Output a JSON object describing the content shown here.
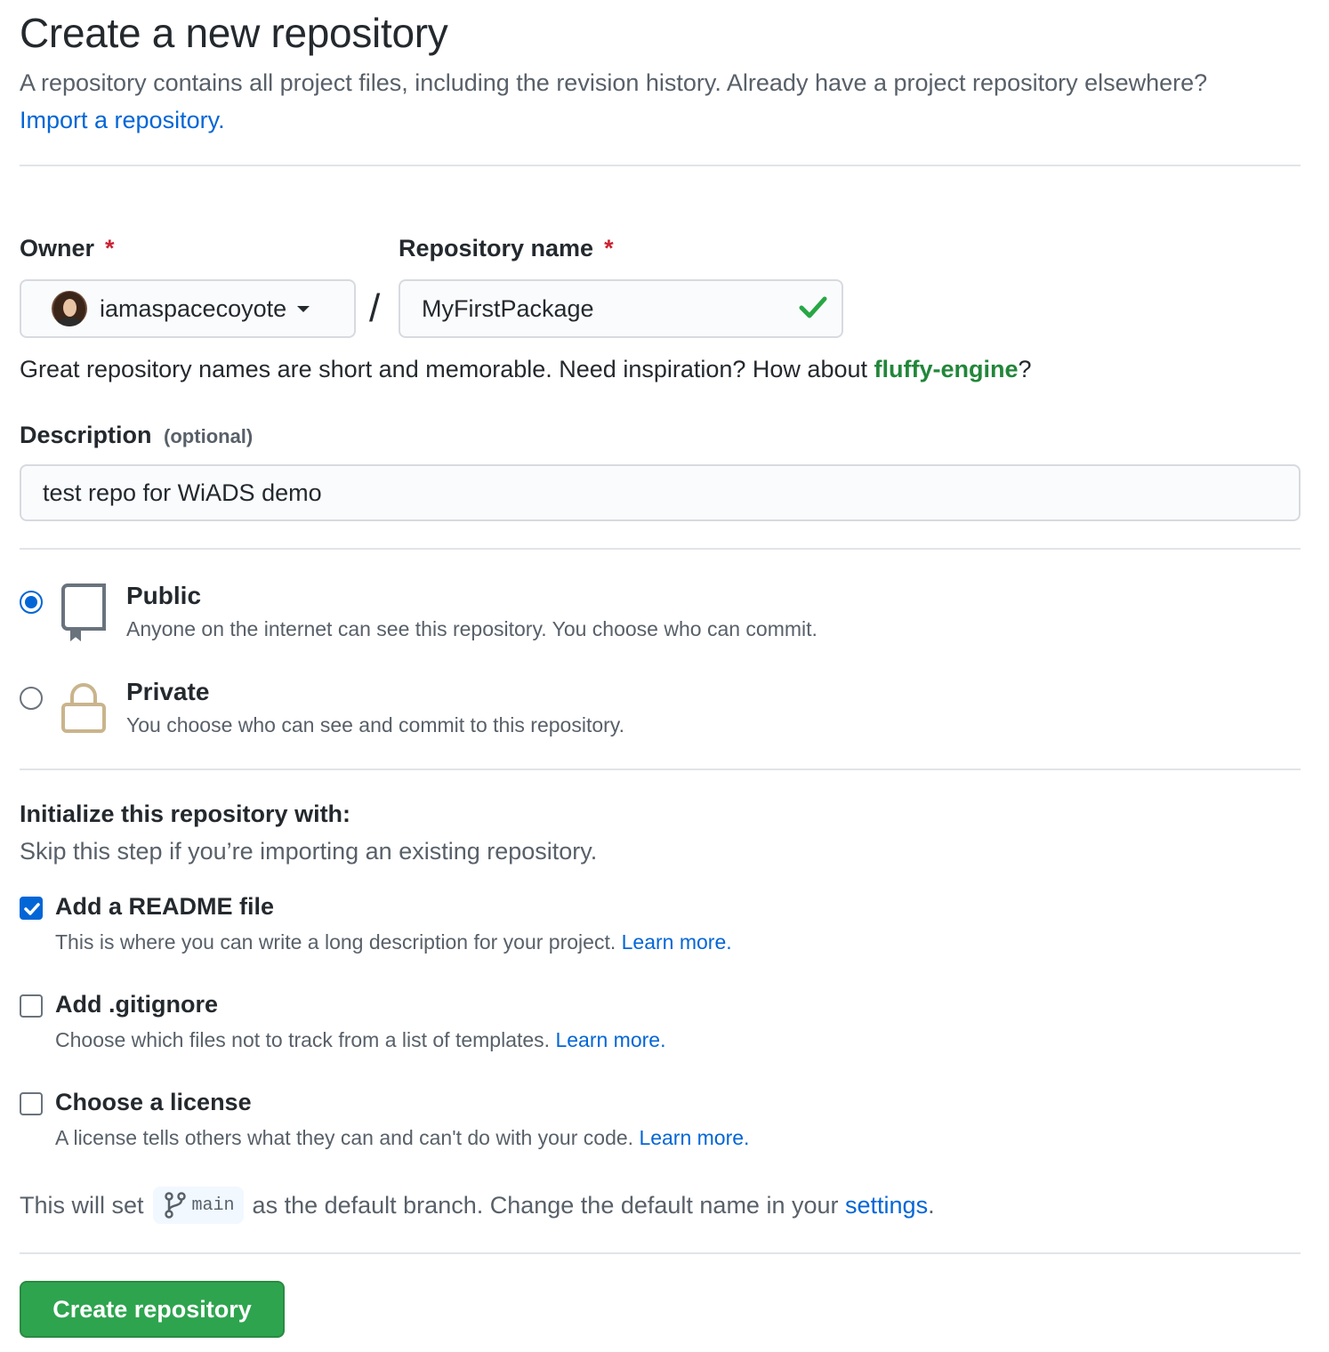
{
  "header": {
    "title": "Create a new repository",
    "subtitle": "A repository contains all project files, including the revision history. Already have a project repository elsewhere?",
    "import_link": "Import a repository."
  },
  "owner": {
    "label": "Owner",
    "required_mark": "*",
    "selected": "iamaspacecoyote"
  },
  "repo_name": {
    "label": "Repository name",
    "required_mark": "*",
    "value": "MyFirstPackage",
    "separator": "/"
  },
  "name_hint": {
    "text": "Great repository names are short and memorable. Need inspiration? How about",
    "suggestion": "fluffy-engine",
    "suffix": "?"
  },
  "description": {
    "label": "Description",
    "optional": "(optional)",
    "value": "test repo for WiADS demo"
  },
  "visibility": {
    "selected": "Public",
    "options": [
      {
        "title": "Public",
        "desc": "Anyone on the internet can see this repository. You choose who can commit."
      },
      {
        "title": "Private",
        "desc": "You choose who can see and commit to this repository."
      }
    ]
  },
  "initialize": {
    "title": "Initialize this repository with:",
    "subtitle": "Skip this step if you’re importing an existing repository.",
    "options": [
      {
        "title": "Add a README file",
        "desc": "This is where you can write a long description for your project.",
        "link": "Learn more.",
        "checked": true
      },
      {
        "title": "Add .gitignore",
        "desc": "Choose which files not to track from a list of templates.",
        "link": "Learn more.",
        "checked": false
      },
      {
        "title": "Choose a license",
        "desc": "A license tells others what they can and can't do with your code.",
        "link": "Learn more.",
        "checked": false
      }
    ]
  },
  "branch": {
    "prefix": "This will set",
    "name": "main",
    "middle": "as the default branch. Change the default name in your",
    "link": "settings",
    "suffix": "."
  },
  "submit": {
    "label": "Create repository"
  },
  "colors": {
    "primary_green": "#2ea44f",
    "link_blue": "#0366d6",
    "required_red": "#cb2431",
    "suggestion_green": "#22863a",
    "muted_text": "#586069"
  },
  "icons": [
    "avatar",
    "caret-down-icon",
    "check-icon",
    "repo-icon",
    "lock-icon",
    "git-branch-icon"
  ]
}
